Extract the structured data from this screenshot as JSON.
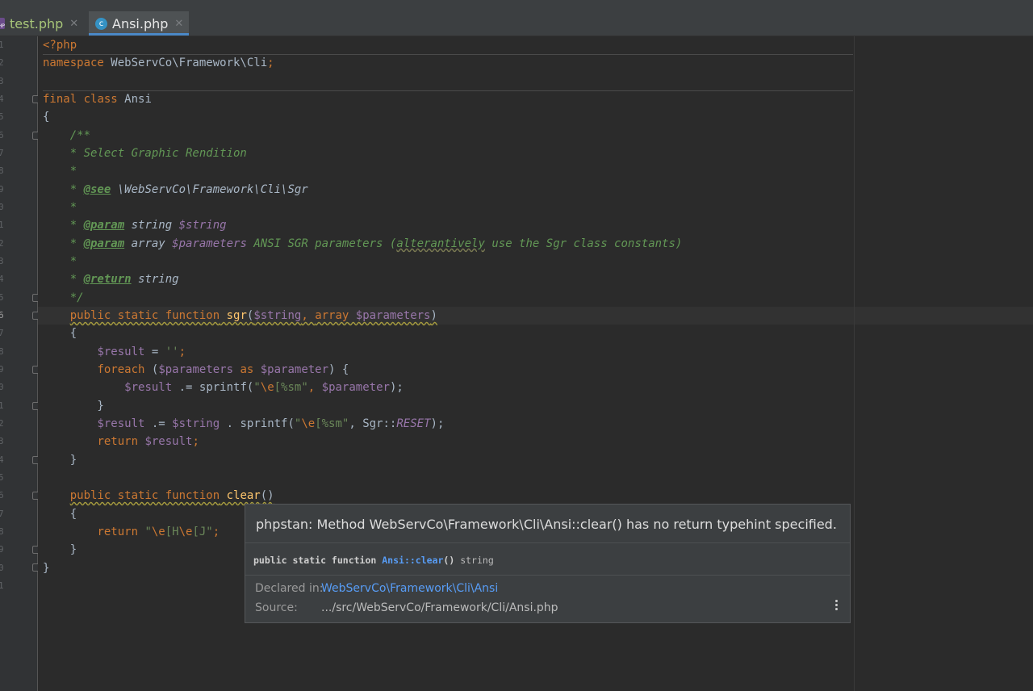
{
  "tabs": [
    {
      "label": "test.php",
      "icon": "php-file-icon",
      "active": false
    },
    {
      "label": "Ansi.php",
      "icon": "php-class-icon",
      "active": true
    }
  ],
  "gutter": [
    "1",
    "2",
    "3",
    "4",
    "5",
    "6",
    "7",
    "8",
    "9",
    "0",
    "1",
    "2",
    "3",
    "4",
    "5",
    "6",
    "7",
    "8",
    "9",
    "0",
    "1",
    "2",
    "3",
    "4",
    "5",
    "6",
    "7",
    "8",
    "9",
    "0",
    "1"
  ],
  "code": {
    "l1": "<?php",
    "l2_kw": "namespace",
    "l2_ns": " WebServCo\\Framework\\Cli",
    "l2_end": ";",
    "l4_kw1": "final",
    "l4_kw2": " class",
    "l4_name": " Ansi",
    "l5": "{",
    "l6": "    /**",
    "l7": "    * Select Graphic Rendition",
    "l8": "    *",
    "l9_pre": "    * ",
    "l9_tag": "@see",
    "l9_rest": " \\WebServCo\\Framework\\Cli\\Sgr",
    "l10": "    *",
    "l11_pre": "    * ",
    "l11_tag": "@param",
    "l11_type": " string",
    "l11_var": " $string",
    "l12_pre": "    * ",
    "l12_tag": "@param",
    "l12_type": " array",
    "l12_var": " $parameters",
    "l12_text1": " ANSI SGR parameters (",
    "l12_typo": "alterantively",
    "l12_text2": " use the Sgr class constants)",
    "l13": "    *",
    "l14_pre": "    * ",
    "l14_tag": "@return",
    "l14_type": " string",
    "l15": "    */",
    "l16_indent": "    ",
    "l16_kw": "public static function",
    "l16_fn": " sgr",
    "l16_p1": "(",
    "l16_v1": "$string",
    "l16_comma": ", ",
    "l16_kw2": "array",
    "l16_v2": " $parameters",
    "l16_p2": ")",
    "l17": "    {",
    "l18_indent": "        ",
    "l18_var": "$result",
    "l18_op": " = ",
    "l18_str": "''",
    "l18_end": ";",
    "l19_indent": "        ",
    "l19_kw": "foreach",
    "l19_p1": " (",
    "l19_v1": "$parameters",
    "l19_as": " as",
    "l19_v2": " $parameter",
    "l19_p2": ") {",
    "l20_indent": "            ",
    "l20_var": "$result",
    "l20_op": " .= sprintf(",
    "l20_s1": "\"",
    "l20_esc": "\\e",
    "l20_s2": "[%sm\"",
    "l20_comma": ", ",
    "l20_v2": "$parameter",
    "l20_end": ");",
    "l21": "        }",
    "l22_indent": "        ",
    "l22_var": "$result",
    "l22_op": " .= ",
    "l22_v2": "$string",
    "l22_mid": " . sprintf(",
    "l22_s1": "\"",
    "l22_esc": "\\e",
    "l22_s2": "[%sm\"",
    "l22_comma": ", Sgr::",
    "l22_const": "RESET",
    "l22_end": ");",
    "l23_indent": "        ",
    "l23_kw": "return",
    "l23_var": " $result",
    "l23_end": ";",
    "l24": "    }",
    "l26_indent": "    ",
    "l26_kw": "public static function",
    "l26_fn": " clear",
    "l26_p": "()",
    "l27": "    {",
    "l28_indent": "        ",
    "l28_kw": "return",
    "l28_s1": " \"",
    "l28_esc1": "\\e",
    "l28_s2": "[H",
    "l28_esc2": "\\e",
    "l28_s3": "[J\"",
    "l28_end": ";",
    "l29": "    }",
    "l30": "}"
  },
  "popup": {
    "message": "phpstan: Method WebServCo\\Framework\\Cli\\Ansi::clear() has no return typehint specified.",
    "sig_kw": "public static function ",
    "sig_link": "Ansi::clear",
    "sig_paren": "()",
    "sig_ret": " string",
    "declared_label": "Declared in:",
    "declared_value": "WebServCo\\Framework\\Cli\\Ansi",
    "source_label": "Source:",
    "source_value": ".../src/WebServCo/Framework/Cli/Ansi.php",
    "more_icon": "vertical-ellipsis-icon"
  },
  "colors": {
    "background": "#2b2b2b",
    "keyword": "#cc7832",
    "variable": "#9876aa",
    "string": "#6a8759",
    "function": "#ffc66d",
    "doc_comment": "#629755",
    "link": "#589df6"
  }
}
